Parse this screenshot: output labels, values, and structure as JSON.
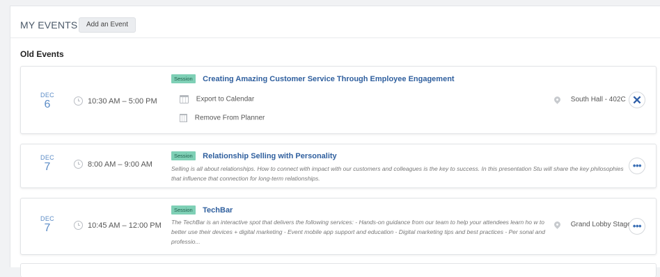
{
  "header": {
    "title": "MY EVENTS",
    "add_button": "Add an Event"
  },
  "section": {
    "title": "Old Events"
  },
  "events": [
    {
      "month": "DEC",
      "day": "6",
      "time": "10:30 AM – 5:00 PM",
      "badge": "Session",
      "title": "Creating Amazing Customer Service Through Employee Engagement",
      "actions": [
        "Export to Calendar",
        "Remove From Planner"
      ],
      "location": "South Hall - 402C",
      "button_glyph": "✕"
    },
    {
      "month": "DEC",
      "day": "7",
      "time": "8:00 AM – 9:00 AM",
      "badge": "Session",
      "title": "Relationship Selling with Personality",
      "description": "Selling is all about relationships. How to connect with impact with our customers and colleagues is the key to success. In this presentation Stu will share the key philosophies that influence that connection for long-term relationships.",
      "button_glyph": "•••"
    },
    {
      "month": "DEC",
      "day": "7",
      "time": "10:45 AM – 12:00 PM",
      "badge": "Session",
      "title": "TechBar",
      "description": "The TechBar is an interactive spot that delivers the following services: - Hands-on guidance from our team to help your attendees learn ho w to better use their devices + digital marketing - Event mobile app support and education - Digital marketing tips and best practices - Per sonal and professio...",
      "location": "Grand Lobby Stage",
      "button_glyph": "•••"
    }
  ],
  "colors": {
    "accent": "#2f5f9e",
    "date": "#5b8bc6",
    "badge": "#7fd0b6"
  }
}
